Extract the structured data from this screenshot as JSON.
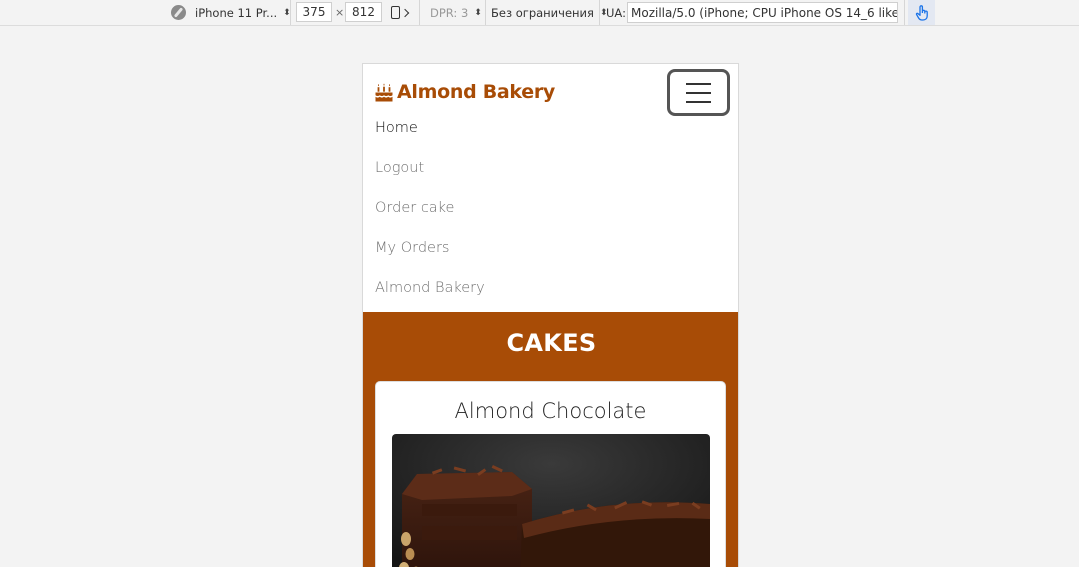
{
  "devtools": {
    "device_name": "iPhone 11 Pr...",
    "width": "375",
    "times": "×",
    "height": "812",
    "dpr": "DPR: 3",
    "throttling": "Без ограничения",
    "ua_label": "UA:",
    "ua_value": "Mozilla/5.0 (iPhone; CPU iPhone OS 14_6 like Mac",
    "icons": [
      "compass-icon",
      "rotate-icon",
      "touch-icon"
    ]
  },
  "site": {
    "brand": "Almond Bakery",
    "brand_icon": "birthday-cake-icon",
    "brand_color": "#a84c06",
    "nav": {
      "items": [
        {
          "label": "Home",
          "active": true
        },
        {
          "label": "Logout"
        },
        {
          "label": "Order cake"
        },
        {
          "label": "My Orders"
        },
        {
          "label": "Almond Bakery"
        }
      ]
    },
    "section_title": "CAKES",
    "cards": [
      {
        "name": "Almond Chocolate"
      }
    ]
  }
}
